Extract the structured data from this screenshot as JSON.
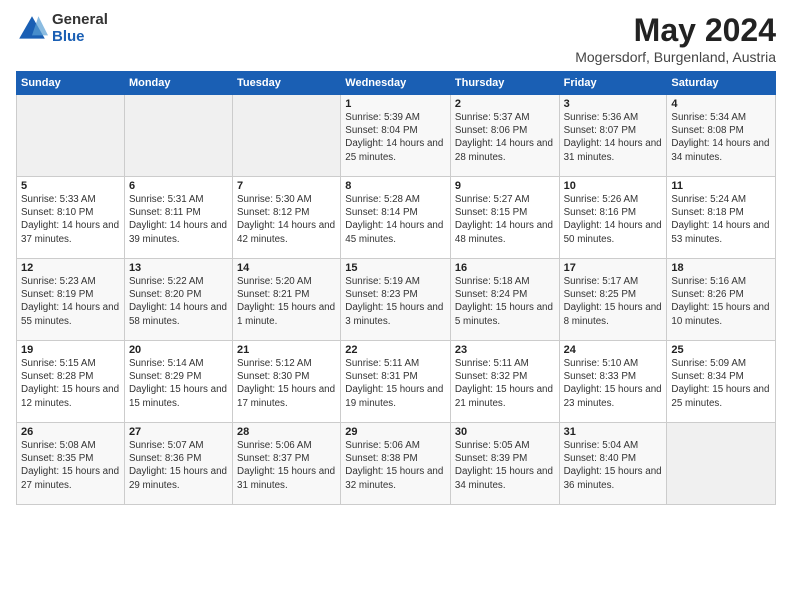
{
  "logo": {
    "general": "General",
    "blue": "Blue"
  },
  "header": {
    "title": "May 2024",
    "subtitle": "Mogersdorf, Burgenland, Austria"
  },
  "days": [
    "Sunday",
    "Monday",
    "Tuesday",
    "Wednesday",
    "Thursday",
    "Friday",
    "Saturday"
  ],
  "weeks": [
    [
      null,
      null,
      null,
      {
        "day": "1",
        "sunrise": "Sunrise: 5:39 AM",
        "sunset": "Sunset: 8:04 PM",
        "daylight": "Daylight: 14 hours and 25 minutes."
      },
      {
        "day": "2",
        "sunrise": "Sunrise: 5:37 AM",
        "sunset": "Sunset: 8:06 PM",
        "daylight": "Daylight: 14 hours and 28 minutes."
      },
      {
        "day": "3",
        "sunrise": "Sunrise: 5:36 AM",
        "sunset": "Sunset: 8:07 PM",
        "daylight": "Daylight: 14 hours and 31 minutes."
      },
      {
        "day": "4",
        "sunrise": "Sunrise: 5:34 AM",
        "sunset": "Sunset: 8:08 PM",
        "daylight": "Daylight: 14 hours and 34 minutes."
      }
    ],
    [
      {
        "day": "5",
        "sunrise": "Sunrise: 5:33 AM",
        "sunset": "Sunset: 8:10 PM",
        "daylight": "Daylight: 14 hours and 37 minutes."
      },
      {
        "day": "6",
        "sunrise": "Sunrise: 5:31 AM",
        "sunset": "Sunset: 8:11 PM",
        "daylight": "Daylight: 14 hours and 39 minutes."
      },
      {
        "day": "7",
        "sunrise": "Sunrise: 5:30 AM",
        "sunset": "Sunset: 8:12 PM",
        "daylight": "Daylight: 14 hours and 42 minutes."
      },
      {
        "day": "8",
        "sunrise": "Sunrise: 5:28 AM",
        "sunset": "Sunset: 8:14 PM",
        "daylight": "Daylight: 14 hours and 45 minutes."
      },
      {
        "day": "9",
        "sunrise": "Sunrise: 5:27 AM",
        "sunset": "Sunset: 8:15 PM",
        "daylight": "Daylight: 14 hours and 48 minutes."
      },
      {
        "day": "10",
        "sunrise": "Sunrise: 5:26 AM",
        "sunset": "Sunset: 8:16 PM",
        "daylight": "Daylight: 14 hours and 50 minutes."
      },
      {
        "day": "11",
        "sunrise": "Sunrise: 5:24 AM",
        "sunset": "Sunset: 8:18 PM",
        "daylight": "Daylight: 14 hours and 53 minutes."
      }
    ],
    [
      {
        "day": "12",
        "sunrise": "Sunrise: 5:23 AM",
        "sunset": "Sunset: 8:19 PM",
        "daylight": "Daylight: 14 hours and 55 minutes."
      },
      {
        "day": "13",
        "sunrise": "Sunrise: 5:22 AM",
        "sunset": "Sunset: 8:20 PM",
        "daylight": "Daylight: 14 hours and 58 minutes."
      },
      {
        "day": "14",
        "sunrise": "Sunrise: 5:20 AM",
        "sunset": "Sunset: 8:21 PM",
        "daylight": "Daylight: 15 hours and 1 minute."
      },
      {
        "day": "15",
        "sunrise": "Sunrise: 5:19 AM",
        "sunset": "Sunset: 8:23 PM",
        "daylight": "Daylight: 15 hours and 3 minutes."
      },
      {
        "day": "16",
        "sunrise": "Sunrise: 5:18 AM",
        "sunset": "Sunset: 8:24 PM",
        "daylight": "Daylight: 15 hours and 5 minutes."
      },
      {
        "day": "17",
        "sunrise": "Sunrise: 5:17 AM",
        "sunset": "Sunset: 8:25 PM",
        "daylight": "Daylight: 15 hours and 8 minutes."
      },
      {
        "day": "18",
        "sunrise": "Sunrise: 5:16 AM",
        "sunset": "Sunset: 8:26 PM",
        "daylight": "Daylight: 15 hours and 10 minutes."
      }
    ],
    [
      {
        "day": "19",
        "sunrise": "Sunrise: 5:15 AM",
        "sunset": "Sunset: 8:28 PM",
        "daylight": "Daylight: 15 hours and 12 minutes."
      },
      {
        "day": "20",
        "sunrise": "Sunrise: 5:14 AM",
        "sunset": "Sunset: 8:29 PM",
        "daylight": "Daylight: 15 hours and 15 minutes."
      },
      {
        "day": "21",
        "sunrise": "Sunrise: 5:12 AM",
        "sunset": "Sunset: 8:30 PM",
        "daylight": "Daylight: 15 hours and 17 minutes."
      },
      {
        "day": "22",
        "sunrise": "Sunrise: 5:11 AM",
        "sunset": "Sunset: 8:31 PM",
        "daylight": "Daylight: 15 hours and 19 minutes."
      },
      {
        "day": "23",
        "sunrise": "Sunrise: 5:11 AM",
        "sunset": "Sunset: 8:32 PM",
        "daylight": "Daylight: 15 hours and 21 minutes."
      },
      {
        "day": "24",
        "sunrise": "Sunrise: 5:10 AM",
        "sunset": "Sunset: 8:33 PM",
        "daylight": "Daylight: 15 hours and 23 minutes."
      },
      {
        "day": "25",
        "sunrise": "Sunrise: 5:09 AM",
        "sunset": "Sunset: 8:34 PM",
        "daylight": "Daylight: 15 hours and 25 minutes."
      }
    ],
    [
      {
        "day": "26",
        "sunrise": "Sunrise: 5:08 AM",
        "sunset": "Sunset: 8:35 PM",
        "daylight": "Daylight: 15 hours and 27 minutes."
      },
      {
        "day": "27",
        "sunrise": "Sunrise: 5:07 AM",
        "sunset": "Sunset: 8:36 PM",
        "daylight": "Daylight: 15 hours and 29 minutes."
      },
      {
        "day": "28",
        "sunrise": "Sunrise: 5:06 AM",
        "sunset": "Sunset: 8:37 PM",
        "daylight": "Daylight: 15 hours and 31 minutes."
      },
      {
        "day": "29",
        "sunrise": "Sunrise: 5:06 AM",
        "sunset": "Sunset: 8:38 PM",
        "daylight": "Daylight: 15 hours and 32 minutes."
      },
      {
        "day": "30",
        "sunrise": "Sunrise: 5:05 AM",
        "sunset": "Sunset: 8:39 PM",
        "daylight": "Daylight: 15 hours and 34 minutes."
      },
      {
        "day": "31",
        "sunrise": "Sunrise: 5:04 AM",
        "sunset": "Sunset: 8:40 PM",
        "daylight": "Daylight: 15 hours and 36 minutes."
      },
      null
    ]
  ]
}
